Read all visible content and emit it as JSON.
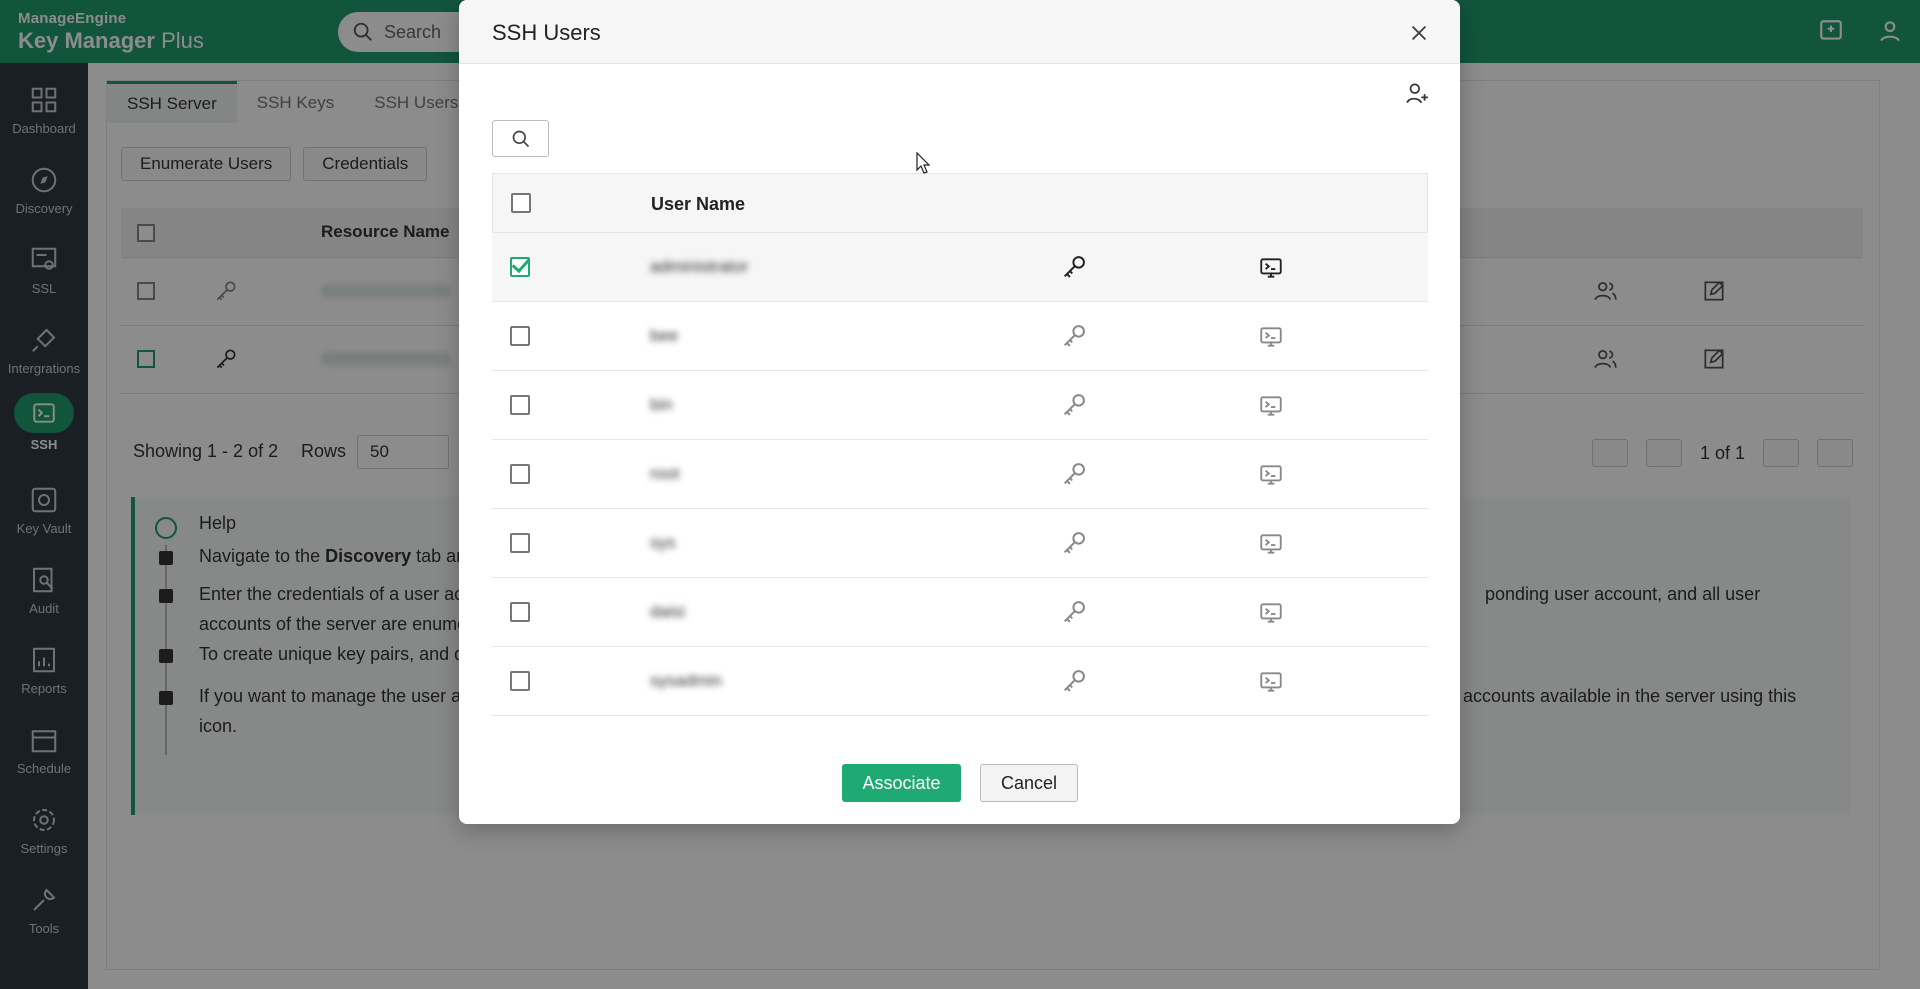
{
  "app": {
    "vendor": "ManageEngine",
    "product_bold": "Key Manager",
    "product_light": " Plus",
    "search_placeholder": "Search"
  },
  "sidebar": {
    "items": [
      {
        "label": "Dashboard",
        "icon": "dashboard-icon"
      },
      {
        "label": "Discovery",
        "icon": "compass-icon"
      },
      {
        "label": "SSL",
        "icon": "certificate-icon"
      },
      {
        "label": "Intergrations",
        "icon": "plug-icon"
      },
      {
        "label": "SSH",
        "icon": "terminal-icon",
        "active": true
      },
      {
        "label": "Key Vault",
        "icon": "vault-icon"
      },
      {
        "label": "Audit",
        "icon": "audit-icon"
      },
      {
        "label": "Reports",
        "icon": "reports-icon"
      },
      {
        "label": "Schedule",
        "icon": "calendar-icon"
      },
      {
        "label": "Settings",
        "icon": "gear-icon"
      },
      {
        "label": "Tools",
        "icon": "tools-icon"
      }
    ]
  },
  "page": {
    "tabs": [
      "SSH Server",
      "SSH Keys",
      "SSH Users"
    ],
    "buttons": [
      "Enumerate Users",
      "Credentials"
    ],
    "table_header": "Resource Name",
    "showing": "Showing 1 - 2 of 2",
    "rows_label": "Rows",
    "rows_value": "50",
    "page_info": "1 of 1",
    "help": {
      "title": "Help",
      "lines": [
        {
          "pre": "Navigate to the ",
          "bold": "Discovery",
          "post": " tab an"
        },
        {
          "text": "Enter the credentials of a user ac",
          "right": "ponding user account, and all user",
          "second": "accounts of the server are enume"
        },
        {
          "text": "To create unique key pairs, and d"
        },
        {
          "text": "If you want to manage the user ac",
          "right": "accounts available in the server using this",
          "second": "icon."
        }
      ]
    }
  },
  "modal": {
    "title": "SSH Users",
    "column_header": "User Name",
    "users": [
      {
        "name": "administrator",
        "checked": true
      },
      {
        "name": "bee",
        "checked": false
      },
      {
        "name": "bin",
        "checked": false
      },
      {
        "name": "root",
        "checked": false
      },
      {
        "name": "sys",
        "checked": false
      },
      {
        "name": "daisi",
        "checked": false
      },
      {
        "name": "sysadmin",
        "checked": false
      }
    ],
    "associate_label": "Associate",
    "cancel_label": "Cancel"
  },
  "colors": {
    "brand_green": "#1f9b6e",
    "accent_green": "#1faa73",
    "sidebar_bg": "#2e3a44"
  }
}
